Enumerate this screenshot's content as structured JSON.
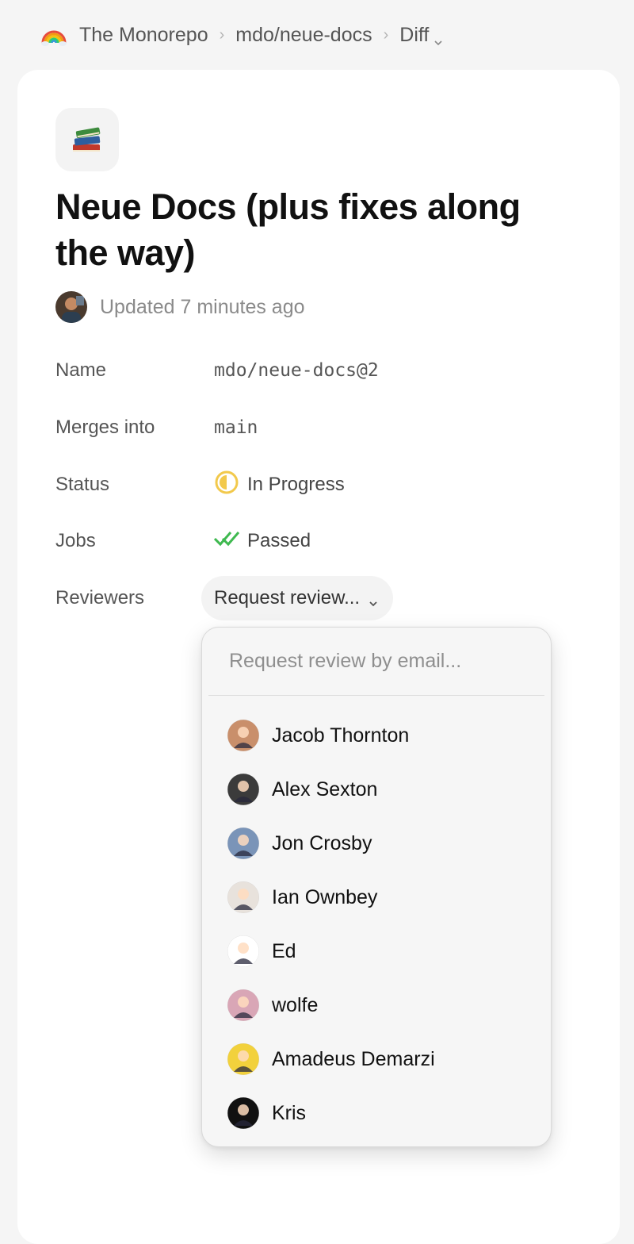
{
  "breadcrumb": {
    "logo_icon": "rainbow-icon",
    "items": [
      "The Monorepo",
      "mdo/neue-docs",
      "Diff"
    ]
  },
  "repo": {
    "icon": "books-icon",
    "title": "Neue Docs (plus fixes along the way)",
    "updated": "Updated 7 minutes ago"
  },
  "details": {
    "name_label": "Name",
    "name_value": "mdo/neue-docs@2",
    "merges_label": "Merges into",
    "merges_value": "main",
    "status_label": "Status",
    "status_value": "In Progress",
    "status_color": "#f2c94c",
    "jobs_label": "Jobs",
    "jobs_value": "Passed",
    "jobs_color": "#3fb950",
    "reviewers_label": "Reviewers",
    "review_button": "Request review..."
  },
  "dropdown": {
    "search_placeholder": "Request review by email...",
    "people": [
      {
        "name": "Jacob Thornton",
        "avatar_color": "#c98f6b"
      },
      {
        "name": "Alex Sexton",
        "avatar_color": "#3b3b3b"
      },
      {
        "name": "Jon Crosby",
        "avatar_color": "#7a94b8"
      },
      {
        "name": "Ian Ownbey",
        "avatar_color": "#e8e2dc"
      },
      {
        "name": "Ed",
        "avatar_color": "#ffffff"
      },
      {
        "name": "wolfe",
        "avatar_color": "#d9a6b6"
      },
      {
        "name": "Amadeus Demarzi",
        "avatar_color": "#f2d13c"
      },
      {
        "name": "Kris",
        "avatar_color": "#111111"
      }
    ]
  }
}
